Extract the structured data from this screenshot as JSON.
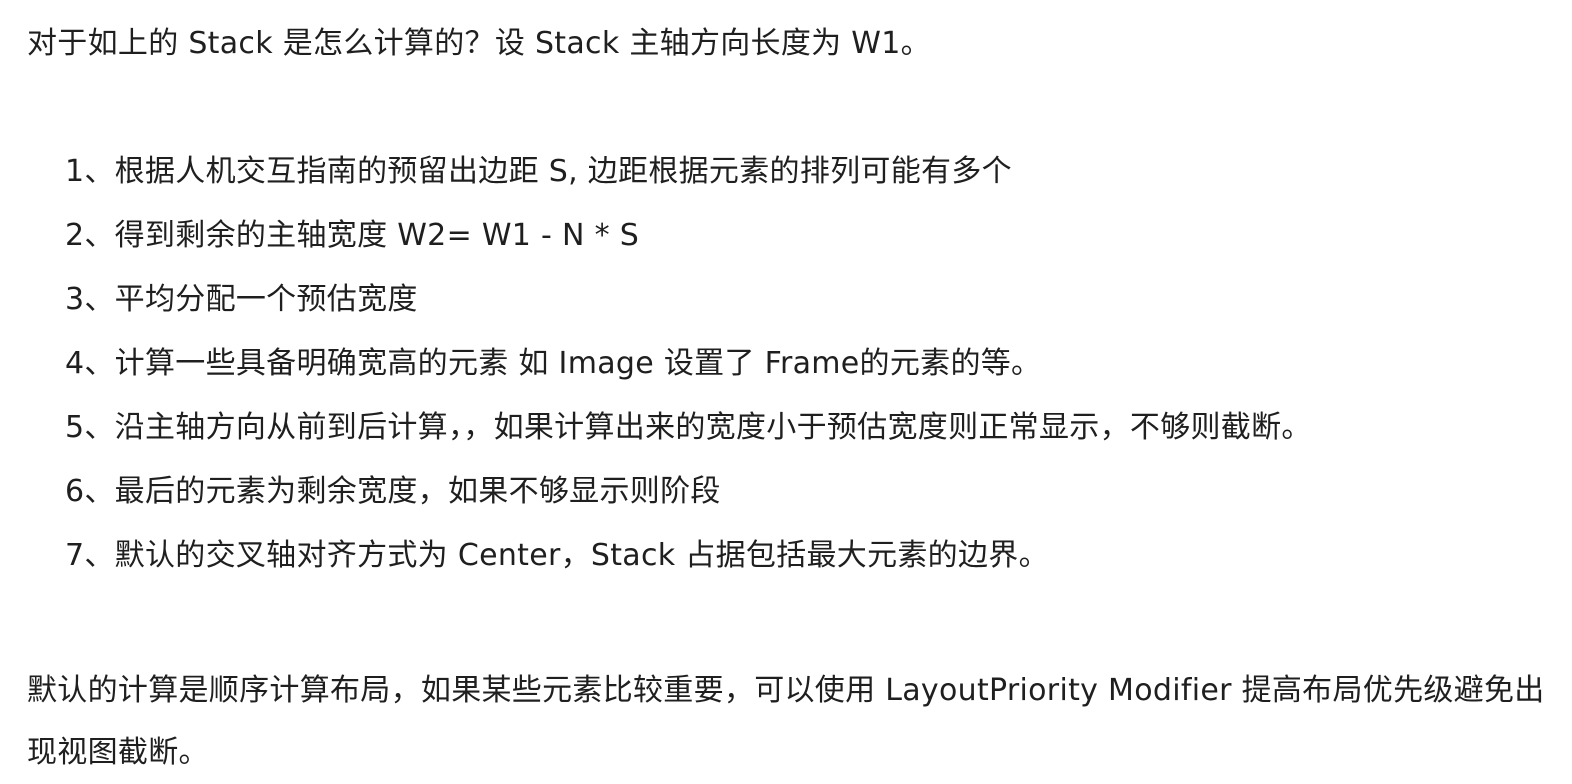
{
  "document": {
    "intro": "对于如上的 Stack 是怎么计算的？设 Stack 主轴方向长度为 W1。",
    "steps": [
      "1、根据人机交互指南的预留出边距 S, 边距根据元素的排列可能有多个",
      "2、得到剩余的主轴宽度 W2= W1 - N * S",
      "3、平均分配一个预估宽度",
      "4、计算一些具备明确宽高的元素 如 Image 设置了 Frame的元素的等。",
      "5、沿主轴方向从前到后计算，，如果计算出来的宽度小于预估宽度则正常显示，不够则截断。",
      "6、最后的元素为剩余宽度，如果不够显示则阶段",
      "7、默认的交叉轴对齐方式为 Center，Stack 占据包括最大元素的边界。"
    ],
    "outro": "默认的计算是顺序计算布局，如果某些元素比较重要，可以使用 LayoutPriority Modifier 提高布局优先级避免出现视图截断。"
  }
}
